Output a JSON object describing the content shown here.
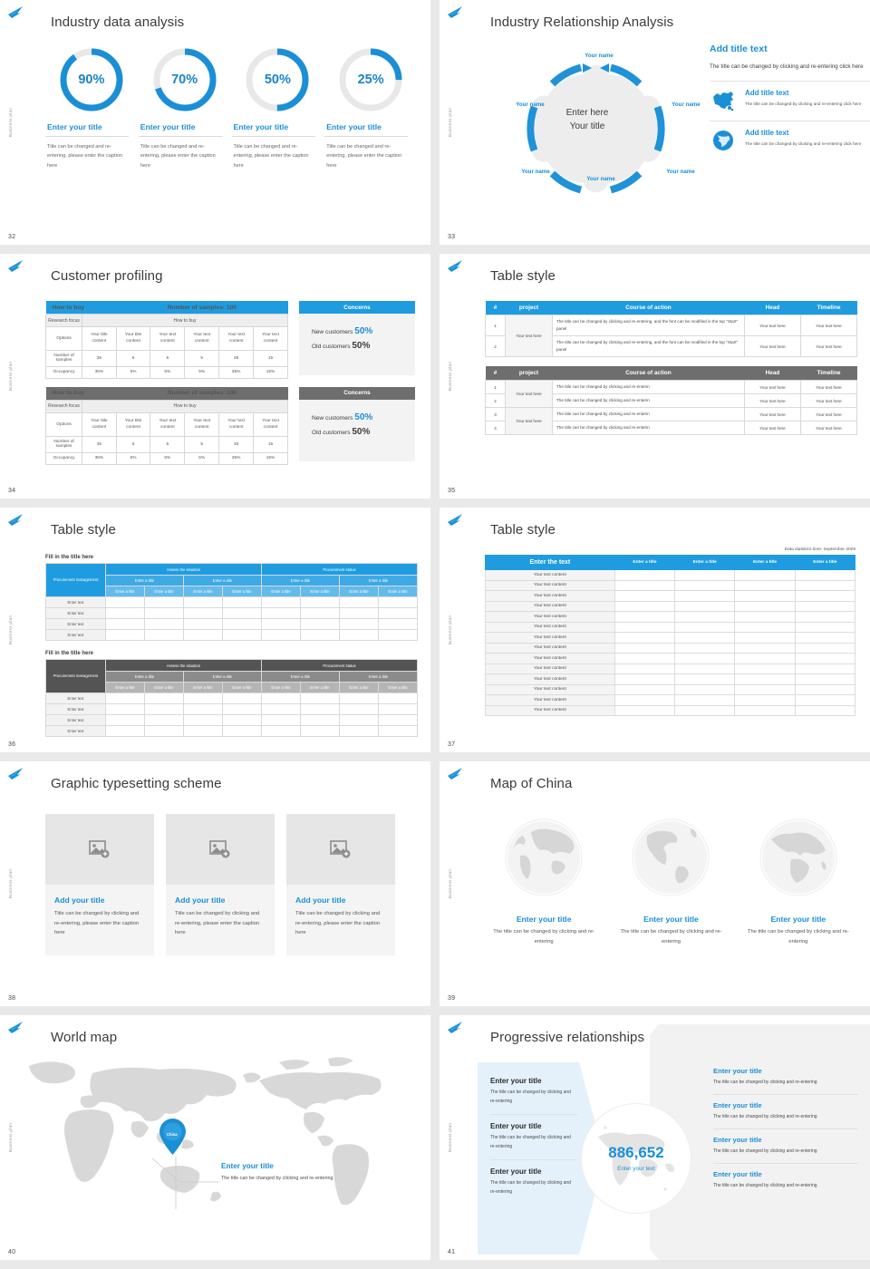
{
  "theme": {
    "accent_blue": "#1a8fd6",
    "header_blue": "#1f9ce0",
    "header_gray": "#6e6e6e",
    "page_bg": "#e9e9e9",
    "map_gray": "#d6d6d6"
  },
  "side_label": "Business plan",
  "slides": [
    {
      "page": "32",
      "title": "Industry data analysis",
      "donuts": [
        {
          "percent": "90%",
          "value": 90,
          "title": "Enter your title",
          "desc": "Title can be changed and re-entering, please enter the caption here"
        },
        {
          "percent": "70%",
          "value": 70,
          "title": "Enter your title",
          "desc": "Title can be changed and re-entering, please enter the caption here"
        },
        {
          "percent": "50%",
          "value": 50,
          "title": "Enter your title",
          "desc": "Title can be changed and re-entering, please enter the caption here"
        },
        {
          "percent": "25%",
          "value": 25,
          "title": "Enter your title",
          "desc": "Title can be changed and re-entering, please enter the caption here"
        }
      ]
    },
    {
      "page": "33",
      "title": "Industry Relationship Analysis",
      "center_line1": "Enter here",
      "center_line2": "Your title",
      "nodes": [
        "Your name",
        "Your name",
        "Your name",
        "Your name",
        "Your name",
        "Your name"
      ],
      "panel": {
        "heading": "Add title text",
        "paragraph": "The title can be changed by clicking and re-entering click here",
        "items": [
          {
            "icon": "china-map-icon",
            "heading": "Add title text",
            "text": "The title can be changed by clicking and re-entering click here"
          },
          {
            "icon": "globe-icon",
            "heading": "Add title text",
            "text": "The title can be changed by clicking and re-entering click here"
          }
        ]
      }
    },
    {
      "page": "34",
      "title": "Customer profiling",
      "tables": [
        {
          "variant": "blue",
          "h_left": "How to buy",
          "h_right": "Number of samples: 100",
          "sub_left": "Research focus",
          "sub_right": "How to buy",
          "row_labels": [
            "Options",
            "Number of samples",
            "Occupancy"
          ],
          "options": [
            "Your title content",
            "Your title content",
            "Your text content",
            "Your text content",
            "Your text content",
            "Your text content"
          ],
          "samples": [
            "35",
            "5",
            "5",
            "5",
            "35",
            "15"
          ],
          "occupancy": [
            "35%",
            "5%",
            "5%",
            "5%",
            "35%",
            "15%"
          ]
        },
        {
          "variant": "gray",
          "h_left": "How to buy",
          "h_right": "Number of samples: 100",
          "sub_left": "Research focus",
          "sub_right": "How to buy",
          "row_labels": [
            "Options",
            "Number of samples",
            "Occupancy"
          ],
          "options": [
            "Your title content",
            "Your title content",
            "Your text content",
            "Your text content",
            "Your text content",
            "Your text content"
          ],
          "samples": [
            "35",
            "5",
            "5",
            "5",
            "35",
            "15"
          ],
          "occupancy": [
            "35%",
            "5%",
            "5%",
            "5%",
            "35%",
            "15%"
          ]
        }
      ],
      "sides": [
        {
          "variant": "blue",
          "heading": "Concerns",
          "line1_label": "New customers",
          "line1_value": "50%",
          "line2_label": "Old customers",
          "line2_value": "50%"
        },
        {
          "variant": "gray",
          "heading": "Concerns",
          "line1_label": "New customers",
          "line1_value": "50%",
          "line2_label": "Old customers",
          "line2_value": "50%"
        }
      ]
    },
    {
      "page": "35",
      "title": "Table style",
      "table_a": {
        "variant": "blue",
        "headers": [
          "#",
          "project",
          "Course of action",
          "Head",
          "Timeline"
        ],
        "rows": [
          {
            "num": "1",
            "project": "Your text here",
            "action": "The title can be changed by clicking and re-entering, and the font can be modified in the top \"Start\" panel",
            "head": "Your text here",
            "timeline": "Your text here"
          },
          {
            "num": "2",
            "project": "",
            "action": "The title can be changed by clicking and re-entering, and the font can be modified in the top \"Start\" panel",
            "head": "Your text here",
            "timeline": "Your text here"
          }
        ]
      },
      "table_b": {
        "variant": "gray",
        "headers": [
          "#",
          "project",
          "Course of action",
          "Head",
          "Timeline"
        ],
        "rows": [
          {
            "num": "1",
            "project": "Your text here",
            "action": "The title can be changed by clicking and re-enterin",
            "head": "Your text here",
            "timeline": "Your text here"
          },
          {
            "num": "2",
            "project": "",
            "action": "The title can be changed by clicking and re-enterin",
            "head": "Your text here",
            "timeline": "Your text here"
          },
          {
            "num": "3",
            "project": "Your text here",
            "action": "The title can be changed by clicking and re-enterin",
            "head": "Your text here",
            "timeline": "Your text here"
          },
          {
            "num": "4",
            "project": "",
            "action": "The title can be changed by clicking and re-enterin",
            "head": "Your text here",
            "timeline": "Your text here"
          }
        ]
      }
    },
    {
      "page": "36",
      "title": "Table style",
      "blocks": [
        {
          "variant": "blue",
          "caption": "Fill in the title here",
          "corner": "Procurement management",
          "groups": [
            "Assess the situation",
            "Procurement status"
          ],
          "subgroups": [
            "Enter a title",
            "Enter a title",
            "Enter a title",
            "Enter a title"
          ],
          "leaf_headers": [
            "Enter a title",
            "Enter a title",
            "Enter a title",
            "Enter a title",
            "Enter a title",
            "Enter a title",
            "Enter a title",
            "Enter a title"
          ],
          "row_labels": [
            "Enter text",
            "Enter text",
            "Enter text",
            "Enter text"
          ]
        },
        {
          "variant": "gray",
          "caption": "Fill in the title here",
          "corner": "Procurement management",
          "groups": [
            "Assess the situation",
            "Procurement status"
          ],
          "subgroups": [
            "Enter a title",
            "Enter a title",
            "Enter a title",
            "Enter a title"
          ],
          "leaf_headers": [
            "Enter a title",
            "Enter a title",
            "Enter a title",
            "Enter a title",
            "Enter a title",
            "Enter a title",
            "Enter a title",
            "Enter a title"
          ],
          "row_labels": [
            "Enter text",
            "Enter text",
            "Enter text",
            "Enter text"
          ]
        }
      ]
    },
    {
      "page": "37",
      "title": "Table style",
      "note": "Data statistics time: September 2029",
      "headers": [
        "Enter the text",
        "Enter a title",
        "Enter a title",
        "Enter a title",
        "Enter a title"
      ],
      "rows": [
        "Your text content",
        "Your text content",
        "Your text content",
        "Your text content",
        "Your text content",
        "Your text content",
        "Your text content",
        "Your text content",
        "Your text content",
        "Your text content",
        "Your text content",
        "Your text content",
        "Your text content",
        "Your text content"
      ]
    },
    {
      "page": "38",
      "title": "Graphic typesetting scheme",
      "cards": [
        {
          "icon": "add-image-icon",
          "heading": "Add your title",
          "text": "Title can be changed by clicking and re-entering, please enter the caption here"
        },
        {
          "icon": "add-image-icon",
          "heading": "Add your title",
          "text": "Title can be changed by clicking and re-entering, please enter the caption here"
        },
        {
          "icon": "add-image-icon",
          "heading": "Add your title",
          "text": "Title can be changed by clicking and re-entering, please enter the caption here"
        }
      ]
    },
    {
      "page": "39",
      "title": "Map of China",
      "globes": [
        {
          "icon": "globe-eurasia-icon",
          "heading": "Enter your title",
          "text": "The title can be changed by clicking and re-entering"
        },
        {
          "icon": "globe-americas-icon",
          "heading": "Enter your title",
          "text": "The title can be changed by clicking and re-entering"
        },
        {
          "icon": "globe-africa-icon",
          "heading": "Enter your title",
          "text": "The title can be changed by clicking and re-entering"
        }
      ]
    },
    {
      "page": "40",
      "title": "World map",
      "pin_label": "China",
      "callout_heading": "Enter your title",
      "callout_text": "The title can be changed by clicking and re-entering"
    },
    {
      "page": "41",
      "title": "Progressive relationships",
      "number": "886,652",
      "number_caption": "Enter your text",
      "left_items": [
        {
          "heading": "Enter your title",
          "text": "The title can be changed by clicking and re-entering"
        },
        {
          "heading": "Enter your title",
          "text": "The title can be changed by clicking and re-entering"
        },
        {
          "heading": "Enter your title",
          "text": "The title can be changed by clicking and re-entering"
        }
      ],
      "right_items": [
        {
          "heading": "Enter your title",
          "text": "The title can be changed by clicking and re-entering"
        },
        {
          "heading": "Enter your title",
          "text": "The title can be changed by clicking and re-entering"
        },
        {
          "heading": "Enter your title",
          "text": "The title can be changed by clicking and re-entering"
        },
        {
          "heading": "Enter your title",
          "text": "The title can be changed by clicking and re-entering"
        }
      ]
    }
  ]
}
